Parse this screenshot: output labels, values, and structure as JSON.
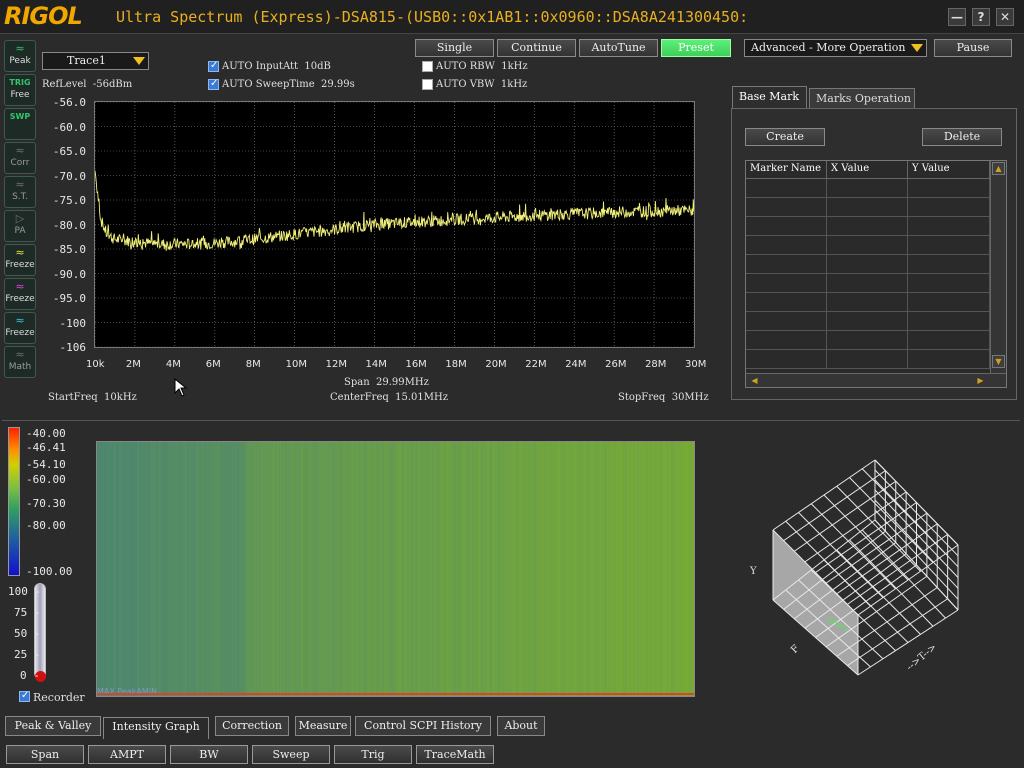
{
  "app": {
    "logo": "RIGOL",
    "title": "Ultra Spectrum (Express)-DSA815-(USB0::0x1AB1::0x0960::DSA8A241300450:"
  },
  "window_controls": {
    "minimize": "—",
    "help": "?",
    "close": "✕"
  },
  "sidebar": [
    {
      "name": "peak",
      "icon": "≈",
      "label": "Peak",
      "active": true
    },
    {
      "name": "trig",
      "icon": "TRIG",
      "label": "Free",
      "active": true
    },
    {
      "name": "swp",
      "icon": "SWP",
      "label": "",
      "active": true
    },
    {
      "name": "corr",
      "icon": "≈",
      "label": "Corr",
      "active": false
    },
    {
      "name": "st",
      "icon": "≈",
      "label": "S.T.",
      "active": false
    },
    {
      "name": "pa",
      "icon": "▷",
      "label": "PA",
      "active": false
    },
    {
      "name": "freeze-yellow",
      "icon": "≈",
      "label": "Freeze",
      "active": true,
      "color": "#f0e040"
    },
    {
      "name": "freeze-magenta",
      "icon": "≈",
      "label": "Freeze",
      "active": true,
      "color": "#e040e0"
    },
    {
      "name": "freeze-cyan",
      "icon": "≈",
      "label": "Freeze",
      "active": true,
      "color": "#30d0d0"
    },
    {
      "name": "math",
      "icon": "≈",
      "label": "Math",
      "active": false
    }
  ],
  "trace_select": "Trace1",
  "ref_level": {
    "label": "RefLevel",
    "value": "-56dBm"
  },
  "auto_inputatt": {
    "label": "AUTO InputAtt",
    "value": "10dB",
    "checked": true
  },
  "auto_sweeptime": {
    "label": "AUTO SweepTime",
    "value": "29.99s",
    "checked": true
  },
  "auto_rbw": {
    "label": "AUTO RBW",
    "value": "1kHz",
    "checked": false
  },
  "auto_vbw": {
    "label": "AUTO VBW",
    "value": "1kHz",
    "checked": false
  },
  "toolbar": {
    "single": "Single",
    "continue": "Continue",
    "autotune": "AutoTune",
    "preset": "Preset",
    "advanced": "Advanced - More Operation",
    "pause": "Pause"
  },
  "plot": {
    "span_label": "Span",
    "span_value": "29.99MHz",
    "start_label": "StartFreq",
    "start_value": "10kHz",
    "center_label": "CenterFreq",
    "center_value": "15.01MHz",
    "stop_label": "StopFreq",
    "stop_value": "30MHz"
  },
  "chart_data": {
    "type": "line",
    "title": "",
    "xlabel": "",
    "ylabel": "",
    "x_tick_labels": [
      "10k",
      "2M",
      "4M",
      "6M",
      "8M",
      "10M",
      "12M",
      "14M",
      "16M",
      "18M",
      "20M",
      "22M",
      "24M",
      "26M",
      "28M",
      "30M"
    ],
    "y_tick_labels": [
      "-56.0",
      "-60.0",
      "-65.0",
      "-70.0",
      "-75.0",
      "-80.0",
      "-85.0",
      "-90.0",
      "-95.0",
      "-100",
      "-106"
    ],
    "xlim_mhz": [
      0.01,
      30
    ],
    "ylim_dbm": [
      -106,
      -56
    ],
    "grid": true,
    "series": [
      {
        "color": "#f0f07a",
        "x_mhz": [
          0.01,
          0.3,
          0.6,
          1,
          2,
          3,
          4,
          5,
          6,
          7,
          8,
          9,
          10,
          11,
          12,
          13,
          14,
          15,
          16,
          17,
          18,
          19,
          20,
          21,
          22,
          23,
          24,
          25,
          26,
          27,
          28,
          29,
          30
        ],
        "y_dbm": [
          -70,
          -80,
          -83,
          -84,
          -84.5,
          -85,
          -85,
          -85,
          -84.8,
          -84.5,
          -84,
          -83.5,
          -83,
          -82.5,
          -82,
          -81.5,
          -81,
          -80.8,
          -80.5,
          -80.3,
          -80,
          -79.8,
          -79.6,
          -79.4,
          -79.2,
          -79,
          -78.8,
          -78.7,
          -78.5,
          -78.4,
          -78.3,
          -78.2,
          -78.2
        ]
      }
    ]
  },
  "marker_panel": {
    "tabs": [
      "Base Mark",
      "Marks Operation"
    ],
    "create": "Create",
    "delete": "Delete",
    "columns": [
      "Marker Name",
      "X Value",
      "Y Value"
    ]
  },
  "intensity": {
    "color_scale": [
      "-40.00",
      "-46.41",
      "-54.10",
      "-60.00",
      "-70.30",
      "-80.00",
      "-100.00"
    ],
    "recorder_ticks": [
      "100",
      "75",
      "50",
      "25",
      "0"
    ],
    "recorder_label": "Recorder",
    "recorder_checked": true,
    "footer_text": "MAX  PeakAMIN"
  },
  "cube_axes": {
    "y": "Y",
    "f": "F",
    "t": "-->T-->"
  },
  "bottom_tabs": [
    "Peak & Valley",
    "Intensity Graph",
    "Correction",
    "Measure",
    "Control SCPI History",
    "About"
  ],
  "function_buttons": [
    "Span",
    "AMPT",
    "BW",
    "Sweep",
    "Trig",
    "TraceMath"
  ]
}
